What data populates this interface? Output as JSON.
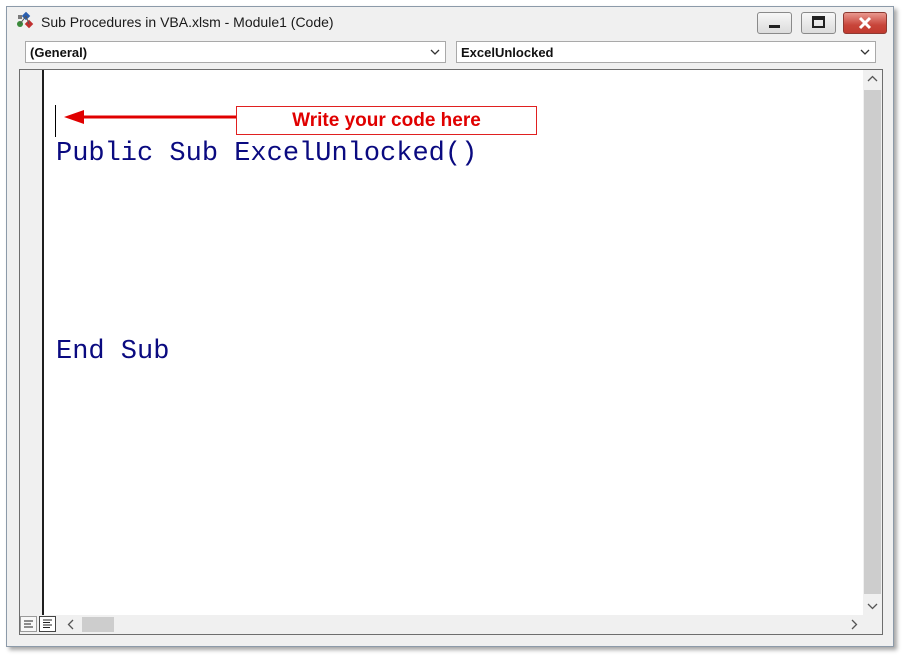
{
  "window": {
    "title": "Sub Procedures in VBA.xlsm - Module1 (Code)"
  },
  "comboboxes": {
    "object": "(General)",
    "procedure": "ExcelUnlocked"
  },
  "code": {
    "lines": [
      "Public Sub ExcelUnlocked()",
      "",
      "End Sub"
    ],
    "keyword_color": "#0a0a80"
  },
  "annotation": {
    "text": "Write your code here",
    "color": "#e00000"
  },
  "icons": {
    "app": "vba-project-icon",
    "minimize": "minimize-icon",
    "maximize": "maximize-icon",
    "close": "close-icon"
  }
}
